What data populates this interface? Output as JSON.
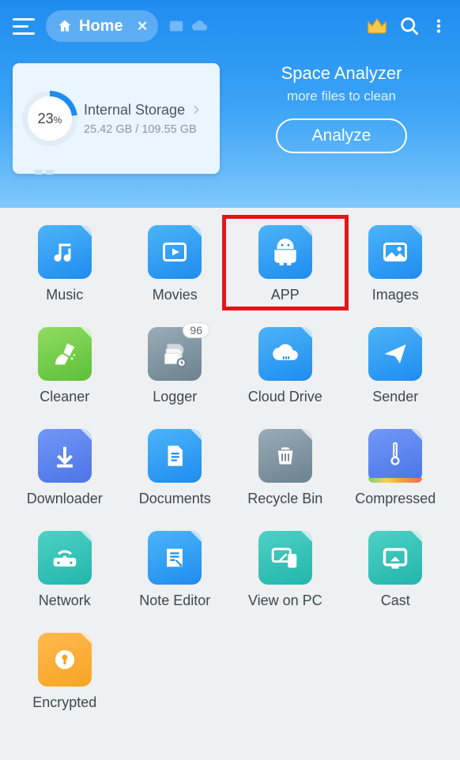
{
  "topbar": {
    "tab_label": "Home"
  },
  "storage": {
    "percent_text": "23",
    "percent_unit": "%",
    "title": "Internal Storage",
    "used": "25.42 GB",
    "total": "109.55 GB"
  },
  "analyzer": {
    "title": "Space Analyzer",
    "subtitle": "more files to clean",
    "button": "Analyze"
  },
  "tiles": {
    "music": "Music",
    "movies": "Movies",
    "app": "APP",
    "images": "Images",
    "cleaner": "Cleaner",
    "logger": "Logger",
    "logger_badge": "96",
    "cloud": "Cloud Drive",
    "sender": "Sender",
    "downloader": "Downloader",
    "documents": "Documents",
    "recycle": "Recycle Bin",
    "compressed": "Compressed",
    "network": "Network",
    "noteeditor": "Note Editor",
    "viewonpc": "View on PC",
    "cast": "Cast",
    "encrypted": "Encrypted"
  }
}
